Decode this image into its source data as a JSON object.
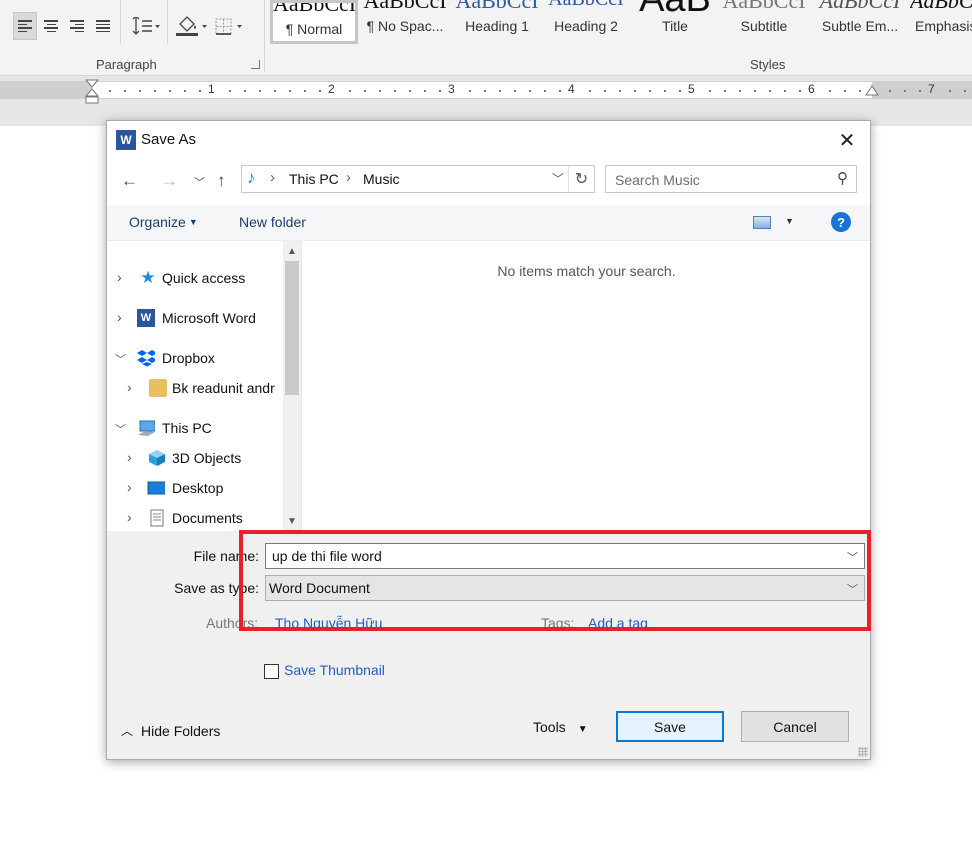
{
  "ribbon": {
    "paragraph_label": "Paragraph",
    "styles_label": "Styles",
    "styles": [
      {
        "preview": "AaBbCcI",
        "name": "¶ Normal",
        "selected": true
      },
      {
        "preview": "AaBbCcI",
        "name": "¶ No Spac..."
      },
      {
        "preview": "AaBbCcI",
        "name": "Heading 1"
      },
      {
        "preview": "AaBbCcI",
        "name": "Heading 2"
      },
      {
        "preview": "AaB",
        "name": "Title"
      },
      {
        "preview": "AaBbCcI",
        "name": "Subtitle"
      },
      {
        "preview": "AaBbCcI",
        "name": "Subtle Em..."
      },
      {
        "preview": "AaBbCcI",
        "name": "Emphasis"
      }
    ]
  },
  "ruler": {
    "numbers": [
      "1",
      "2",
      "3",
      "4",
      "5",
      "6",
      "7"
    ]
  },
  "dialog": {
    "title": "Save As",
    "address": {
      "crumb1": "This PC",
      "crumb2": "Music"
    },
    "search_placeholder": "Search Music",
    "toolbar": {
      "organize_label": "Organize",
      "new_folder_label": "New folder"
    },
    "tree": [
      {
        "label": "Quick access",
        "icon": "quick-access-star-icon",
        "expanded": false,
        "level": 0
      },
      {
        "label": "Microsoft Word",
        "icon": "word-icon",
        "expanded": false,
        "level": 0
      },
      {
        "label": "Dropbox",
        "icon": "dropbox-icon",
        "expanded": true,
        "level": 0
      },
      {
        "label": "Bk readunit andr",
        "icon": "user-folder-icon",
        "expanded": false,
        "level": 1
      },
      {
        "label": "This PC",
        "icon": "this-pc-icon",
        "expanded": true,
        "level": 0
      },
      {
        "label": "3D Objects",
        "icon": "3d-objects-icon",
        "expanded": false,
        "level": 1
      },
      {
        "label": "Desktop",
        "icon": "desktop-icon",
        "expanded": false,
        "level": 1
      },
      {
        "label": "Documents",
        "icon": "documents-icon",
        "expanded": false,
        "level": 1
      }
    ],
    "empty_message": "No items match your search.",
    "form": {
      "file_name_label": "File name:",
      "file_name_value": "up de thi file word",
      "save_type_label": "Save as type:",
      "save_type_value": "Word Document",
      "authors_label": "Authors:",
      "authors_value": "Tho Nguyễn Hữu",
      "tags_label": "Tags:",
      "tags_value": "Add a tag",
      "save_thumbnail_label": "Save Thumbnail"
    },
    "footer": {
      "hide_folders_label": "Hide Folders",
      "tools_label": "Tools",
      "save_label": "Save",
      "cancel_label": "Cancel"
    }
  },
  "colors": {
    "highlight": "#e8202a",
    "word_blue": "#2b579a",
    "link_blue": "#1f5fbf",
    "primary_border": "#0078d7"
  }
}
